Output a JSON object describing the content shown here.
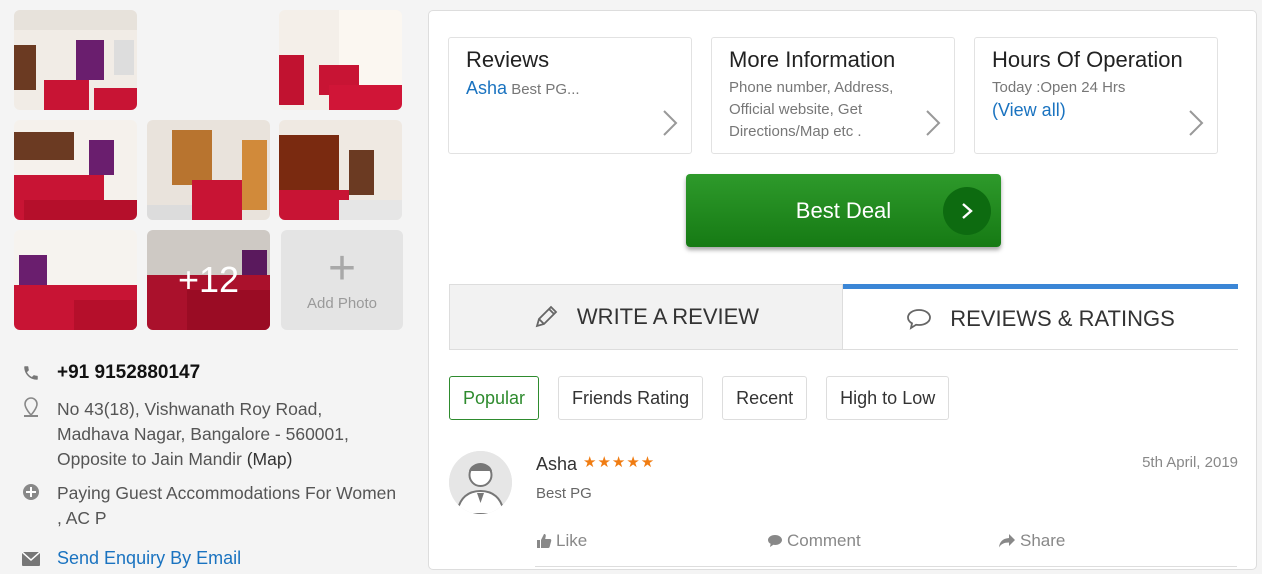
{
  "gallery": {
    "more_count": "+12",
    "add_photo_label": "Add Photo"
  },
  "contact": {
    "phone": "+91 9152880147",
    "address": "No 43(18), Vishwanath Roy Road, Madhava Nagar, Bangalore - 560001, Opposite to Jain Mandir",
    "map_link": "(Map)",
    "category": "Paying Guest Accommodations For Women , AC P",
    "enquiry_link": "Send Enquiry By Email"
  },
  "cards": {
    "reviews": {
      "title": "Reviews",
      "name": "Asha",
      "snippet": "Best PG..."
    },
    "more_info": {
      "title": "More Information",
      "desc": "Phone number, Address, Official website, Get Directions/Map etc ."
    },
    "hours": {
      "title": "Hours Of Operation",
      "today": "Today :Open 24 Hrs",
      "view_all": "(View all)"
    }
  },
  "deal_button": {
    "label": "Best Deal"
  },
  "tabs": {
    "write": "WRITE A REVIEW",
    "reviews": "REVIEWS & RATINGS"
  },
  "filters": [
    "Popular",
    "Friends Rating",
    "Recent",
    "High to Low"
  ],
  "review": {
    "name": "Asha",
    "stars": "★★★★★",
    "rating": 5,
    "date": "5th April, 2019",
    "text": "Best PG",
    "like": "Like",
    "comment": "Comment",
    "share": "Share"
  },
  "colors": {
    "accent_blue": "#1a73c0",
    "deal_green": "#1f8a1d",
    "star_orange": "#f07c12",
    "tab_active": "#3b86d6"
  }
}
